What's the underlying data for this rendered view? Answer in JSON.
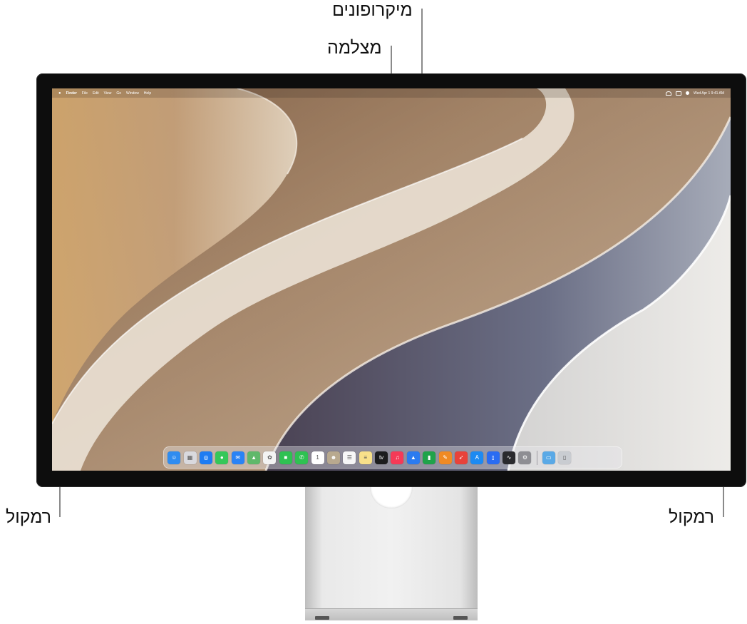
{
  "callouts": {
    "microphones": "מיקרופונים",
    "camera": "מצלמה",
    "speaker_left": "רמקול",
    "speaker_right": "רמקול"
  },
  "menubar": {
    "apple": "",
    "items": [
      "Finder",
      "File",
      "Edit",
      "View",
      "Go",
      "Window",
      "Help"
    ],
    "clock": "Wed Apr 1  9:41 AM"
  },
  "dock": {
    "apps": [
      {
        "name": "finder-icon",
        "color": "#2f8cf0",
        "glyph": "☺"
      },
      {
        "name": "launchpad-icon",
        "color": "#d9d9de",
        "glyph": "▦"
      },
      {
        "name": "safari-icon",
        "color": "#1e7cf2",
        "glyph": "◎"
      },
      {
        "name": "messages-icon",
        "color": "#35c759",
        "glyph": "●"
      },
      {
        "name": "mail-icon",
        "color": "#2a83f5",
        "glyph": "✉"
      },
      {
        "name": "maps-icon",
        "color": "#5fb86a",
        "glyph": "▲"
      },
      {
        "name": "photos-icon",
        "color": "#f3f3f3",
        "glyph": "✿"
      },
      {
        "name": "facetime-icon",
        "color": "#2fc152",
        "glyph": "■"
      },
      {
        "name": "phone-icon",
        "color": "#2fc152",
        "glyph": "✆"
      },
      {
        "name": "calendar-icon",
        "color": "#ffffff",
        "glyph": "1"
      },
      {
        "name": "contacts-icon",
        "color": "#b8a98f",
        "glyph": "☻"
      },
      {
        "name": "reminders-icon",
        "color": "#f7f7f7",
        "glyph": "☰"
      },
      {
        "name": "notes-icon",
        "color": "#f8e08a",
        "glyph": "≡"
      },
      {
        "name": "tv-icon",
        "color": "#1c1c1e",
        "glyph": "tv"
      },
      {
        "name": "music-icon",
        "color": "#f53a57",
        "glyph": "♫"
      },
      {
        "name": "keynote-icon",
        "color": "#2b7bf0",
        "glyph": "▲"
      },
      {
        "name": "numbers-icon",
        "color": "#1fa34a",
        "glyph": "▮"
      },
      {
        "name": "pages-icon",
        "color": "#f08a24",
        "glyph": "✎"
      },
      {
        "name": "rocket-icon",
        "color": "#e8423a",
        "glyph": "➶"
      },
      {
        "name": "app-store-icon",
        "color": "#1d8af2",
        "glyph": "A"
      },
      {
        "name": "iphone-mirroring-icon",
        "color": "#2a6cf2",
        "glyph": "▯"
      },
      {
        "name": "activity-monitor-icon",
        "color": "#2a2a2e",
        "glyph": "∿"
      },
      {
        "name": "system-settings-icon",
        "color": "#8e8e93",
        "glyph": "⚙"
      }
    ],
    "extras": [
      {
        "name": "downloads-folder-icon",
        "color": "#5aa9e6",
        "glyph": "▭"
      },
      {
        "name": "trash-icon",
        "color": "#c9ccd1",
        "glyph": "▯"
      }
    ]
  }
}
